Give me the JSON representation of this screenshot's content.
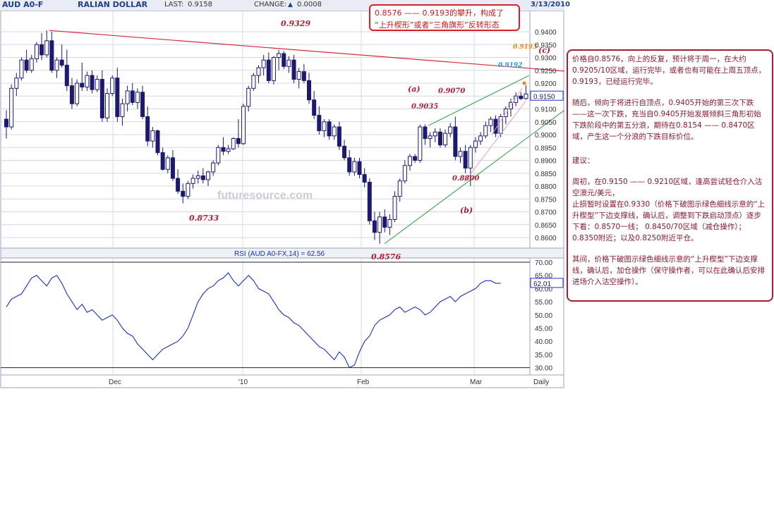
{
  "header": {
    "symbol": "AUD A0-F",
    "name": "RALIAN DOLLAR",
    "last_label": "LAST:",
    "last_value": "0.9158",
    "change_label": "CHANGE:",
    "change_value": "0.0008",
    "date": "3/13/2010",
    "up_icon": "triangle-up-icon"
  },
  "callout": {
    "line1": "0.8576 —— 0.9193的攀升，构成了",
    "line2": "“上升楔形”或者“三角旗形”反转形态"
  },
  "commentary": {
    "p1": "价格自0.8576，向上的反复，预计将于周一，在大约0.9205/10区域，运行完毕，或者也有可能在上周五顶点，0.9193，已经运行完毕。",
    "p2": "随后，倾向于将进行自顶点，0.9405开始的第三次下跌——这一次下跌，充当自0.9405开始发展倾斜三角形初始下跌阶段中的第五分浪，期待在0.8154 —— 0.8470区域，产生这一个分浪的下跌目标价位。",
    "p3": "建议：",
    "p4": "周初，在0.9150 —— 0.9210区域，逢高尝试轻仓介入沽空澳元/美元，",
    "p5": "止损暂时设置在0.9330（价格下破图示绿色细线示意的“上升楔型”下边支撑线，确认后，调整到下跌启动顶点）逐步下看：0.8570一线； 0.8450/70区域（减仓操作）；0.8350附近；以及0.8250附近平仓。",
    "p6": "其间，价格下破图示绿色细线示意的“上升楔型”下边支撑线，确认后，加仓操作（保守操作者，可以在此确认后安排进场介入沽空操作）。"
  },
  "watermark": "futuresource.com",
  "colors": {
    "up": "#ffffff",
    "down": "#1b1a6e",
    "grid": "#d3d8e3",
    "trend_red": "#d8283a",
    "channel_green": "#2c9a3a",
    "label_red": "#b01c35",
    "rsi": "#1a2fbf",
    "price_box": "#2233cc"
  },
  "chart_data": [
    {
      "type": "candlestick",
      "title": "AUD A0-FX",
      "ylim": [
        0.8575,
        0.9475
      ],
      "yticks": [
        "0.8600",
        "0.8650",
        "0.8700",
        "0.8750",
        "0.8800",
        "0.8850",
        "0.8900",
        "0.8950",
        "0.9000",
        "0.9050",
        "0.9100",
        "0.9150",
        "0.9200",
        "0.9250",
        "0.9300",
        "0.9350",
        "0.9400"
      ],
      "xticks": [
        "Dec",
        "'10",
        "Feb",
        "Mar",
        "Daily"
      ],
      "current_price": "0.9150",
      "high_annotation": "0.9405",
      "annotations": [
        "0.9329",
        "0.8733",
        "0.8576",
        "0.9035",
        "0.9070",
        "0.8800",
        "0.9193",
        "0.9192",
        "(a)",
        "(b)",
        "(c)"
      ],
      "candles": [
        [
          0.906,
          0.9095,
          0.8985,
          0.903
        ],
        [
          0.903,
          0.9195,
          0.902,
          0.918
        ],
        [
          0.918,
          0.924,
          0.915,
          0.922
        ],
        [
          0.922,
          0.93,
          0.921,
          0.929
        ],
        [
          0.929,
          0.933,
          0.924,
          0.925
        ],
        [
          0.925,
          0.931,
          0.924,
          0.9295
        ],
        [
          0.9295,
          0.936,
          0.928,
          0.935
        ],
        [
          0.935,
          0.9395,
          0.929,
          0.931
        ],
        [
          0.931,
          0.9405,
          0.93,
          0.9365
        ],
        [
          0.9365,
          0.94,
          0.924,
          0.925
        ],
        [
          0.925,
          0.93,
          0.922,
          0.929
        ],
        [
          0.929,
          0.935,
          0.926,
          0.927
        ],
        [
          0.927,
          0.933,
          0.917,
          0.919
        ],
        [
          0.919,
          0.922,
          0.91,
          0.912
        ],
        [
          0.912,
          0.9215,
          0.911,
          0.92
        ],
        [
          0.92,
          0.928,
          0.917,
          0.9185
        ],
        [
          0.9185,
          0.9245,
          0.917,
          0.923
        ],
        [
          0.923,
          0.925,
          0.916,
          0.9175
        ],
        [
          0.9175,
          0.923,
          0.9165,
          0.9215
        ],
        [
          0.9215,
          0.925,
          0.905,
          0.9065
        ],
        [
          0.9065,
          0.918,
          0.905,
          0.916
        ],
        [
          0.916,
          0.923,
          0.915,
          0.922
        ],
        [
          0.922,
          0.926,
          0.905,
          0.907
        ],
        [
          0.907,
          0.914,
          0.9035,
          0.912
        ],
        [
          0.912,
          0.919,
          0.909,
          0.917
        ],
        [
          0.917,
          0.92,
          0.9115,
          0.9125
        ],
        [
          0.9125,
          0.918,
          0.91,
          0.9165
        ],
        [
          0.9165,
          0.919,
          0.906,
          0.907
        ],
        [
          0.907,
          0.911,
          0.8955,
          0.8975
        ],
        [
          0.8975,
          0.903,
          0.895,
          0.9015
        ],
        [
          0.9015,
          0.902,
          0.892,
          0.893
        ],
        [
          0.893,
          0.895,
          0.886,
          0.8865
        ],
        [
          0.8865,
          0.892,
          0.885,
          0.891
        ],
        [
          0.891,
          0.894,
          0.882,
          0.883
        ],
        [
          0.883,
          0.8865,
          0.877,
          0.878
        ],
        [
          0.878,
          0.881,
          0.8733,
          0.876
        ],
        [
          0.876,
          0.882,
          0.875,
          0.881
        ],
        [
          0.881,
          0.8845,
          0.879,
          0.883
        ],
        [
          0.883,
          0.886,
          0.881,
          0.884
        ],
        [
          0.884,
          0.887,
          0.881,
          0.8825
        ],
        [
          0.8825,
          0.886,
          0.88,
          0.8855
        ],
        [
          0.8855,
          0.89,
          0.884,
          0.889
        ],
        [
          0.889,
          0.896,
          0.888,
          0.895
        ],
        [
          0.895,
          0.899,
          0.892,
          0.8935
        ],
        [
          0.8935,
          0.896,
          0.8925,
          0.8945
        ],
        [
          0.8945,
          0.899,
          0.894,
          0.8985
        ],
        [
          0.8985,
          0.906,
          0.895,
          0.8965
        ],
        [
          0.8965,
          0.912,
          0.896,
          0.911
        ],
        [
          0.911,
          0.919,
          0.909,
          0.918
        ],
        [
          0.918,
          0.924,
          0.917,
          0.923
        ],
        [
          0.923,
          0.927,
          0.92,
          0.926
        ],
        [
          0.926,
          0.931,
          0.923,
          0.929
        ],
        [
          0.929,
          0.932,
          0.92,
          0.921
        ],
        [
          0.921,
          0.9305,
          0.9195,
          0.93
        ],
        [
          0.93,
          0.9329,
          0.925,
          0.9315
        ],
        [
          0.9315,
          0.9325,
          0.9255,
          0.9265
        ],
        [
          0.9265,
          0.9305,
          0.924,
          0.929
        ],
        [
          0.929,
          0.931,
          0.92,
          0.9215
        ],
        [
          0.9215,
          0.926,
          0.918,
          0.9245
        ],
        [
          0.9245,
          0.9275,
          0.92,
          0.921
        ],
        [
          0.921,
          0.924,
          0.912,
          0.9135
        ],
        [
          0.9135,
          0.917,
          0.906,
          0.9075
        ],
        [
          0.9075,
          0.911,
          0.9,
          0.9015
        ],
        [
          0.9015,
          0.906,
          0.899,
          0.905
        ],
        [
          0.905,
          0.906,
          0.898,
          0.8995
        ],
        [
          0.8995,
          0.904,
          0.898,
          0.903
        ],
        [
          0.903,
          0.905,
          0.894,
          0.8955
        ],
        [
          0.8955,
          0.898,
          0.89,
          0.891
        ],
        [
          0.891,
          0.894,
          0.884,
          0.8855
        ],
        [
          0.8855,
          0.891,
          0.884,
          0.8895
        ],
        [
          0.8895,
          0.891,
          0.883,
          0.8845
        ],
        [
          0.8845,
          0.887,
          0.8795,
          0.8815
        ],
        [
          0.8815,
          0.883,
          0.865,
          0.8665
        ],
        [
          0.8665,
          0.87,
          0.859,
          0.862
        ],
        [
          0.862,
          0.87,
          0.8576,
          0.868
        ],
        [
          0.868,
          0.871,
          0.862,
          0.864
        ],
        [
          0.864,
          0.869,
          0.861,
          0.867
        ],
        [
          0.867,
          0.878,
          0.866,
          0.876
        ],
        [
          0.876,
          0.883,
          0.874,
          0.882
        ],
        [
          0.882,
          0.89,
          0.881,
          0.888
        ],
        [
          0.888,
          0.8925,
          0.886,
          0.8915
        ],
        [
          0.8915,
          0.8925,
          0.889,
          0.89
        ],
        [
          0.89,
          0.904,
          0.889,
          0.903
        ],
        [
          0.903,
          0.904,
          0.896,
          0.8985
        ],
        [
          0.8985,
          0.901,
          0.895,
          0.8995
        ],
        [
          0.8995,
          0.9025,
          0.897,
          0.901
        ],
        [
          0.901,
          0.9025,
          0.895,
          0.896
        ],
        [
          0.896,
          0.902,
          0.895,
          0.9005
        ],
        [
          0.9005,
          0.9045,
          0.899,
          0.903
        ],
        [
          0.903,
          0.907,
          0.89,
          0.8915
        ],
        [
          0.8915,
          0.895,
          0.889,
          0.8935
        ],
        [
          0.8935,
          0.896,
          0.885,
          0.887
        ],
        [
          0.887,
          0.896,
          0.88,
          0.895
        ],
        [
          0.895,
          0.899,
          0.893,
          0.8975
        ],
        [
          0.8975,
          0.901,
          0.896,
          0.8995
        ],
        [
          0.8995,
          0.905,
          0.8985,
          0.9035
        ],
        [
          0.9035,
          0.907,
          0.901,
          0.906
        ],
        [
          0.906,
          0.9075,
          0.899,
          0.9005
        ],
        [
          0.9005,
          0.908,
          0.899,
          0.907
        ],
        [
          0.907,
          0.911,
          0.904,
          0.91
        ],
        [
          0.91,
          0.914,
          0.907,
          0.9125
        ],
        [
          0.9125,
          0.9165,
          0.911,
          0.915
        ],
        [
          0.915,
          0.9165,
          0.9135,
          0.914
        ],
        [
          0.914,
          0.9193,
          0.9135,
          0.9158
        ]
      ]
    },
    {
      "type": "line",
      "title": "RSI (AUD A0-FX,14) = 62.56",
      "ylim": [
        28,
        72
      ],
      "yticks": [
        "30.00",
        "35.00",
        "40.00",
        "45.00",
        "50.00",
        "55.00",
        "60.00",
        "65.00",
        "70.00"
      ],
      "current_value": "62.01",
      "values": [
        53,
        56,
        57,
        58,
        61,
        64,
        65,
        63,
        61,
        64,
        65,
        62,
        58,
        55,
        52,
        54,
        51,
        52,
        50,
        48,
        49,
        50,
        48,
        45,
        43,
        42,
        39,
        37,
        35,
        33,
        35,
        37,
        38,
        39,
        40,
        42,
        45,
        50,
        55,
        58,
        60,
        61,
        63,
        64,
        66,
        63,
        61,
        63,
        65,
        63,
        60,
        59,
        58,
        55,
        52,
        50,
        49,
        47,
        46,
        44,
        42,
        40,
        38,
        37,
        35,
        33,
        36,
        34,
        30,
        31,
        36,
        40,
        42,
        46,
        48,
        49,
        50,
        52,
        53,
        51,
        52,
        53,
        52,
        50,
        51,
        53,
        55,
        56,
        57,
        55,
        57,
        58,
        59,
        60,
        62,
        63,
        63,
        62,
        62
      ]
    }
  ]
}
